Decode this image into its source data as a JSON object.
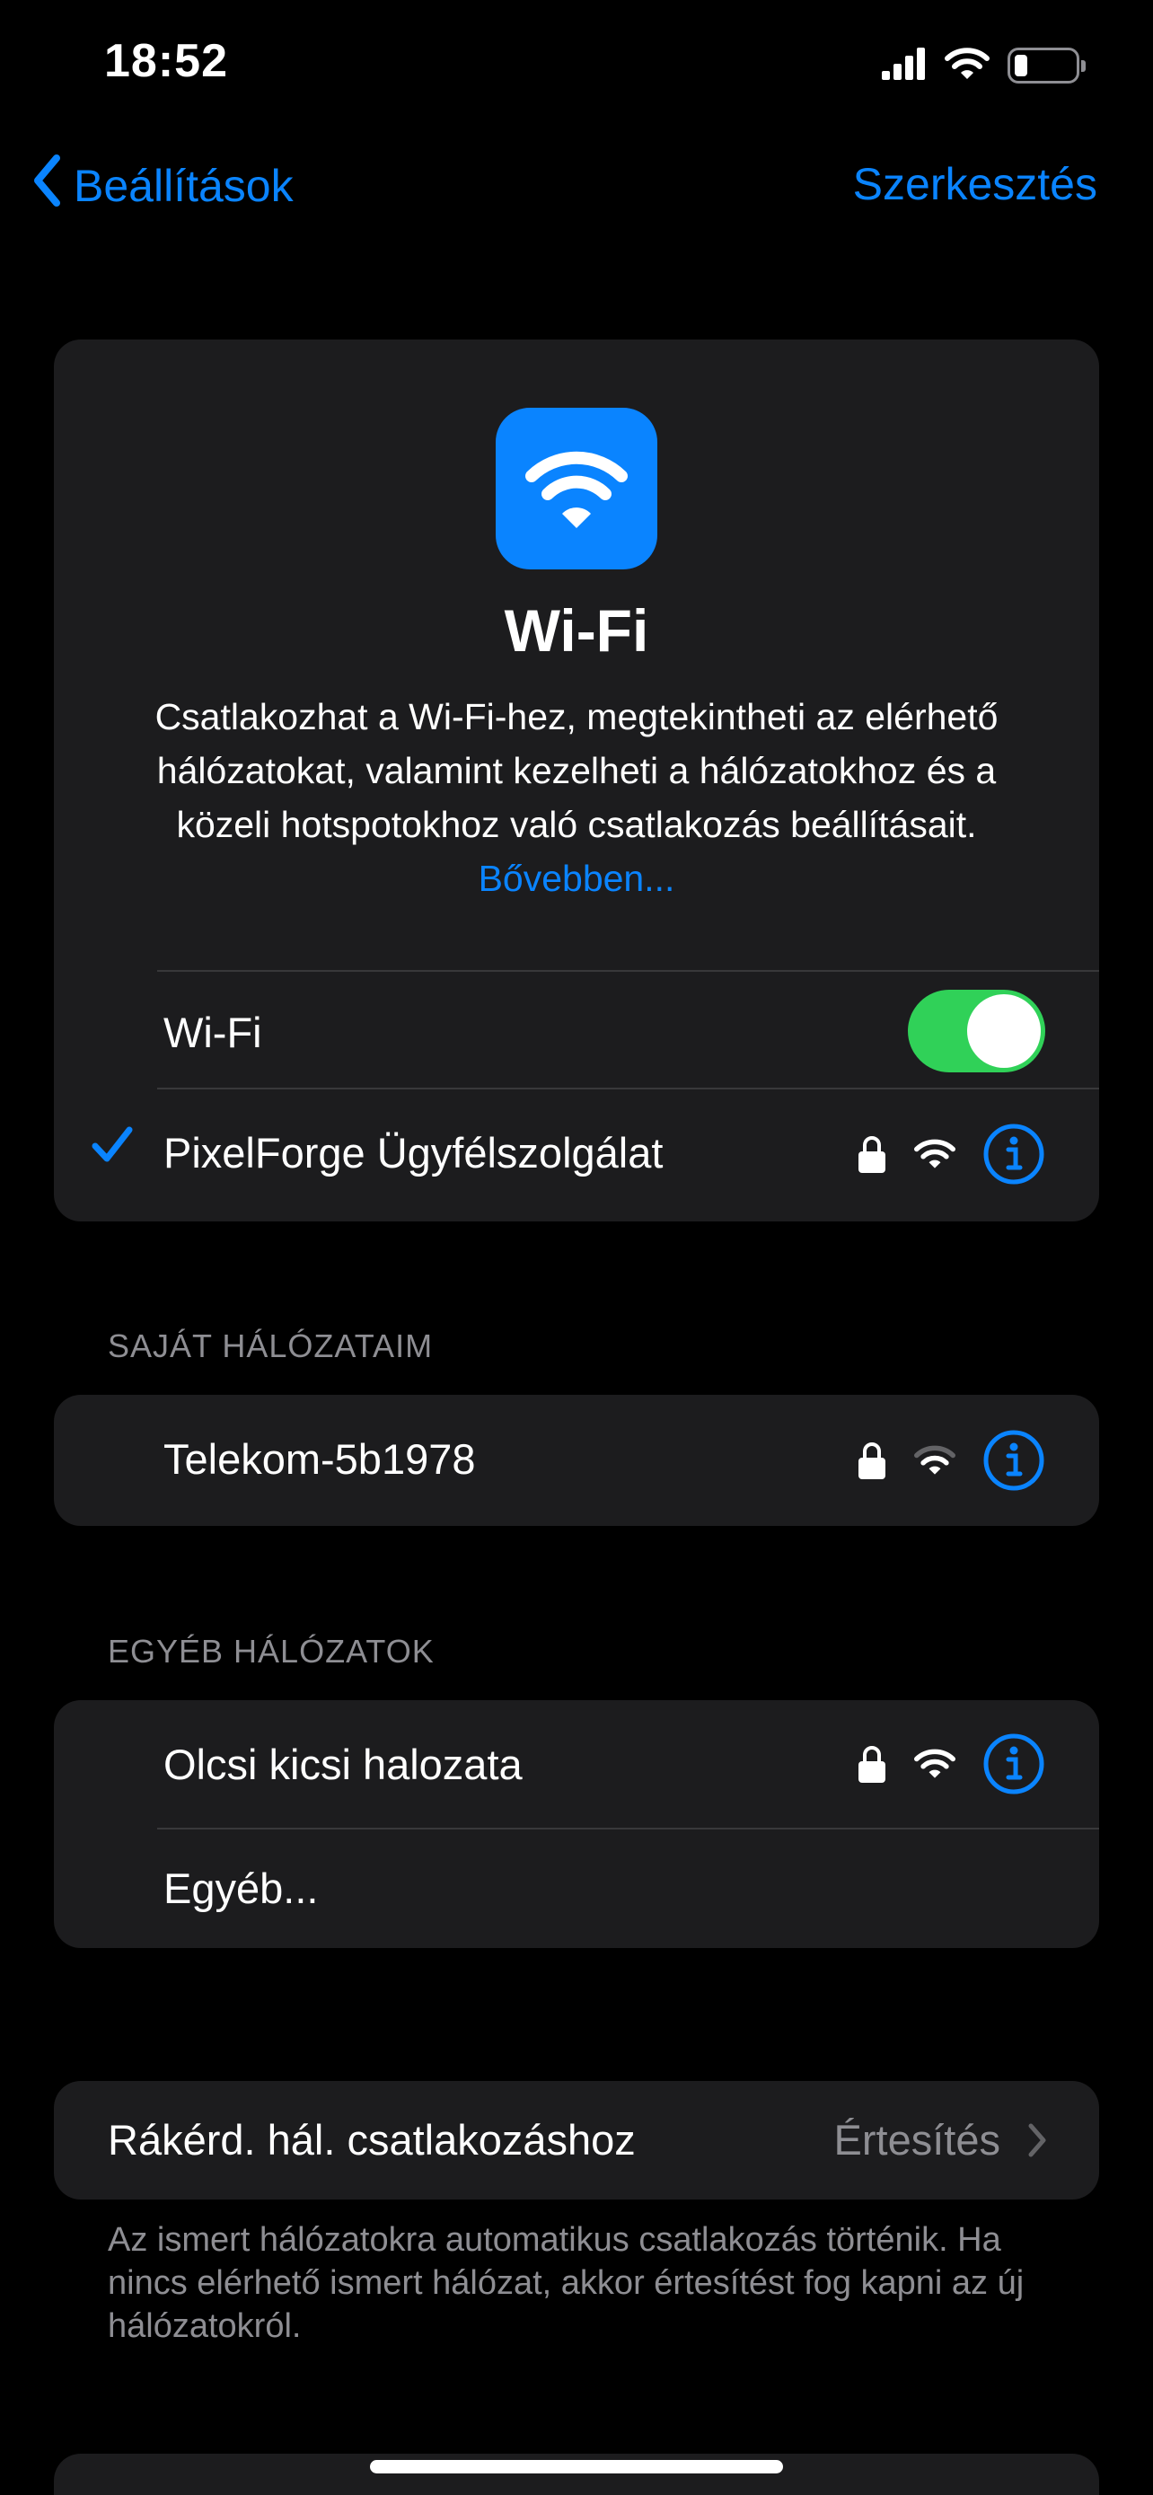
{
  "status_bar": {
    "time": "18:52",
    "icons": [
      "cellular-signal-icon",
      "wifi-icon",
      "battery-icon"
    ]
  },
  "nav": {
    "back_label": "Beállítások",
    "edit_label": "Szerkesztés"
  },
  "hero": {
    "icon": "wifi-icon",
    "title": "Wi-Fi",
    "description": "Csatlakozhat a Wi-Fi-hez, megtekintheti az elérhető hálózatokat, valamint kezelheti a hálózatokhoz és a közeli hotspotokhoz való csatlakozás beállításait.",
    "more_link": "Bővebben...",
    "wifi_toggle_label": "Wi-Fi",
    "wifi_enabled": true,
    "connected_network": "PixelForge Ügyfélszolgálat"
  },
  "my_networks": {
    "header": "SAJÁT HÁLÓZATAIM",
    "items": [
      {
        "name": "Telekom-5b1978",
        "locked": true
      }
    ]
  },
  "other_networks": {
    "header": "EGYÉB HÁLÓZATOK",
    "items": [
      {
        "name": "Olcsi kicsi halozata",
        "locked": true
      }
    ],
    "other_label": "Egyéb..."
  },
  "ask_join": {
    "label": "Rákérd. hál. csatlakozáshoz",
    "value": "Értesítés",
    "note": "Az ismert hálózatokra automatikus csatlakozás történik. Ha nincs elérhető ismert hálózat, akkor értesítést fog kapni az új hálózatokról."
  },
  "colors": {
    "accent": "#0a84ff",
    "toggle_on": "#30d158",
    "card_bg": "#1c1c1e",
    "secondary_text": "#8e8e93"
  }
}
